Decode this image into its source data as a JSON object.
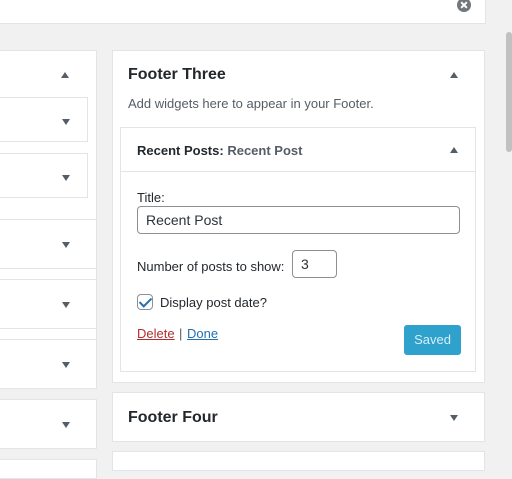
{
  "footer_three": {
    "title": "Footer Three",
    "description": "Add widgets here to appear in your Footer."
  },
  "widget": {
    "title_prefix": "Recent Posts:",
    "title_instance": "Recent Post",
    "title_label": "Title:",
    "title_value": "Recent Post",
    "num_posts_label": "Number of posts to show:",
    "num_posts_value": "3",
    "display_date_label": "Display post date?",
    "display_date_checked": true,
    "delete_label": "Delete",
    "separator": "|",
    "done_label": "Done",
    "saved_label": "Saved"
  },
  "footer_four": {
    "title": "Footer Four"
  },
  "icons": {
    "clear": "clear-search-icon",
    "collapse": "caret-up-icon",
    "expand": "caret-down-icon"
  },
  "colors": {
    "background": "#f1f1f1",
    "saved_button": "#2ea2cc",
    "delete_link": "#b32d2e",
    "done_link": "#2271b1"
  }
}
